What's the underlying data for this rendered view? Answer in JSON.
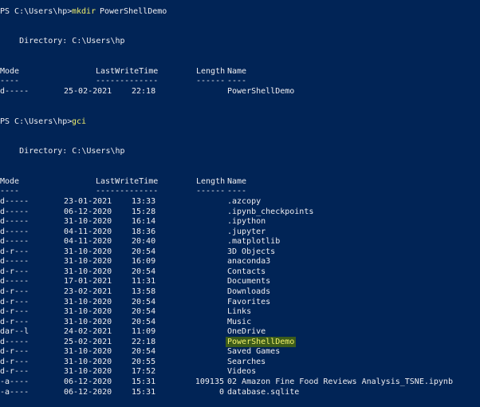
{
  "colors": {
    "background": "#012456",
    "text": "#EEEDF0",
    "command": "#F2F06B",
    "highlight": "#3C5C1A"
  },
  "prompt1": {
    "prompt": "PS C:\\Users\\hp> ",
    "command": "mkdir",
    "args": "PowerShellDemo"
  },
  "dir1": "    Directory: C:\\Users\\hp",
  "headers": {
    "mode": "Mode",
    "lwt": "LastWriteTime",
    "length": "Length",
    "name": "Name"
  },
  "underlines": {
    "mode": "----",
    "lwt": "-------------",
    "length": "------",
    "name": "----"
  },
  "mkdir_result": {
    "mode": "d-----",
    "date": "25-02-2021",
    "time": "22:18",
    "length": "",
    "name": "PowerShellDemo"
  },
  "prompt2": {
    "prompt": "PS C:\\Users\\hp> ",
    "command": "gci"
  },
  "dir2": "    Directory: C:\\Users\\hp",
  "rows": [
    {
      "mode": "d-----",
      "date": "23-01-2021",
      "time": "13:33",
      "length": "",
      "name": ".azcopy"
    },
    {
      "mode": "d-----",
      "date": "06-12-2020",
      "time": "15:28",
      "length": "",
      "name": ".ipynb_checkpoints"
    },
    {
      "mode": "d-----",
      "date": "31-10-2020",
      "time": "16:14",
      "length": "",
      "name": ".ipython"
    },
    {
      "mode": "d-----",
      "date": "04-11-2020",
      "time": "18:36",
      "length": "",
      "name": ".jupyter"
    },
    {
      "mode": "d-----",
      "date": "04-11-2020",
      "time": "20:40",
      "length": "",
      "name": ".matplotlib"
    },
    {
      "mode": "d-r---",
      "date": "31-10-2020",
      "time": "20:54",
      "length": "",
      "name": "3D Objects"
    },
    {
      "mode": "d-----",
      "date": "31-10-2020",
      "time": "16:09",
      "length": "",
      "name": "anaconda3"
    },
    {
      "mode": "d-r---",
      "date": "31-10-2020",
      "time": "20:54",
      "length": "",
      "name": "Contacts"
    },
    {
      "mode": "d-----",
      "date": "17-01-2021",
      "time": "11:31",
      "length": "",
      "name": "Documents"
    },
    {
      "mode": "d-r---",
      "date": "23-02-2021",
      "time": "13:58",
      "length": "",
      "name": "Downloads"
    },
    {
      "mode": "d-r---",
      "date": "31-10-2020",
      "time": "20:54",
      "length": "",
      "name": "Favorites"
    },
    {
      "mode": "d-r---",
      "date": "31-10-2020",
      "time": "20:54",
      "length": "",
      "name": "Links"
    },
    {
      "mode": "d-r---",
      "date": "31-10-2020",
      "time": "20:54",
      "length": "",
      "name": "Music"
    },
    {
      "mode": "dar--l",
      "date": "24-02-2021",
      "time": "11:09",
      "length": "",
      "name": "OneDrive"
    },
    {
      "mode": "d-----",
      "date": "25-02-2021",
      "time": "22:18",
      "length": "",
      "name": "PowerShellDemo",
      "highlighted": true
    },
    {
      "mode": "d-r---",
      "date": "31-10-2020",
      "time": "20:54",
      "length": "",
      "name": "Saved Games"
    },
    {
      "mode": "d-r---",
      "date": "31-10-2020",
      "time": "20:55",
      "length": "",
      "name": "Searches"
    },
    {
      "mode": "d-r---",
      "date": "31-10-2020",
      "time": "17:52",
      "length": "",
      "name": "Videos"
    },
    {
      "mode": "-a----",
      "date": "06-12-2020",
      "time": "15:31",
      "length": "109135",
      "name": "02 Amazon Fine Food Reviews Analysis_TSNE.ipynb"
    },
    {
      "mode": "-a----",
      "date": "06-12-2020",
      "time": "15:31",
      "length": "0",
      "name": "database.sqlite"
    }
  ]
}
